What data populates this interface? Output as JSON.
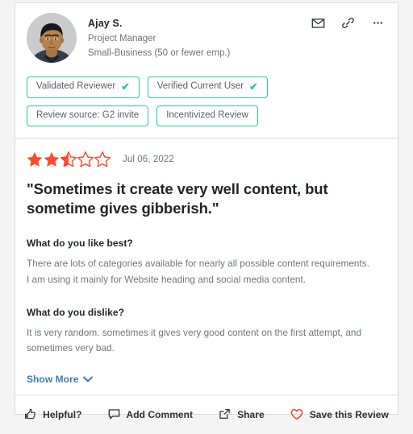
{
  "card": {
    "reviewer": {
      "name": "Ajay S.",
      "role": "Project Manager",
      "company_size": "Small-Business (50 or fewer emp.)",
      "avatar_alt": "avatar-photo"
    },
    "header_icons": [
      {
        "name": "email-icon",
        "label": "Email"
      },
      {
        "name": "link-icon",
        "label": "Copy link"
      },
      {
        "name": "more-options-icon",
        "label": "More options"
      }
    ],
    "badges": [
      {
        "label": "Validated Reviewer",
        "check": "✔"
      },
      {
        "label": "Verified Current User",
        "check": "✔"
      },
      {
        "label": "Review source: G2 invite",
        "check": ""
      },
      {
        "label": "Incentivized Review",
        "check": ""
      }
    ],
    "rating": {
      "value": 2.5,
      "max": 5,
      "date": "Jul 06, 2022"
    },
    "title": "\"Sometimes it create very well content, but sometime gives gibberish.\"",
    "sections": [
      {
        "question": "What do you like best?",
        "answer": "There are lots of categories available for nearly all possible content requirements. I am using it mainly for Website heading and social media content."
      },
      {
        "question": "What do you dislike?",
        "answer": "It is very random. sometimes it gives very good content on the first attempt, and sometimes very bad."
      }
    ],
    "show_more": "Show More",
    "footer_actions": [
      {
        "label": "Helpful?",
        "icon": "thumbs-up-icon"
      },
      {
        "label": "Add Comment",
        "icon": "comment-icon"
      },
      {
        "label": "Share",
        "icon": "share-icon"
      },
      {
        "label": "Save this Review",
        "icon": "heart-icon"
      }
    ]
  },
  "colors": {
    "badge_border": "#29c99a",
    "star_filled": "#ff492c",
    "link_blue": "#3d7cb0",
    "heart_red": "#f5402c",
    "text_dark": "#20242b",
    "text_muted": "#70767f",
    "card_border": "#d9dbdd",
    "page_bg": "#f4f4f4"
  }
}
